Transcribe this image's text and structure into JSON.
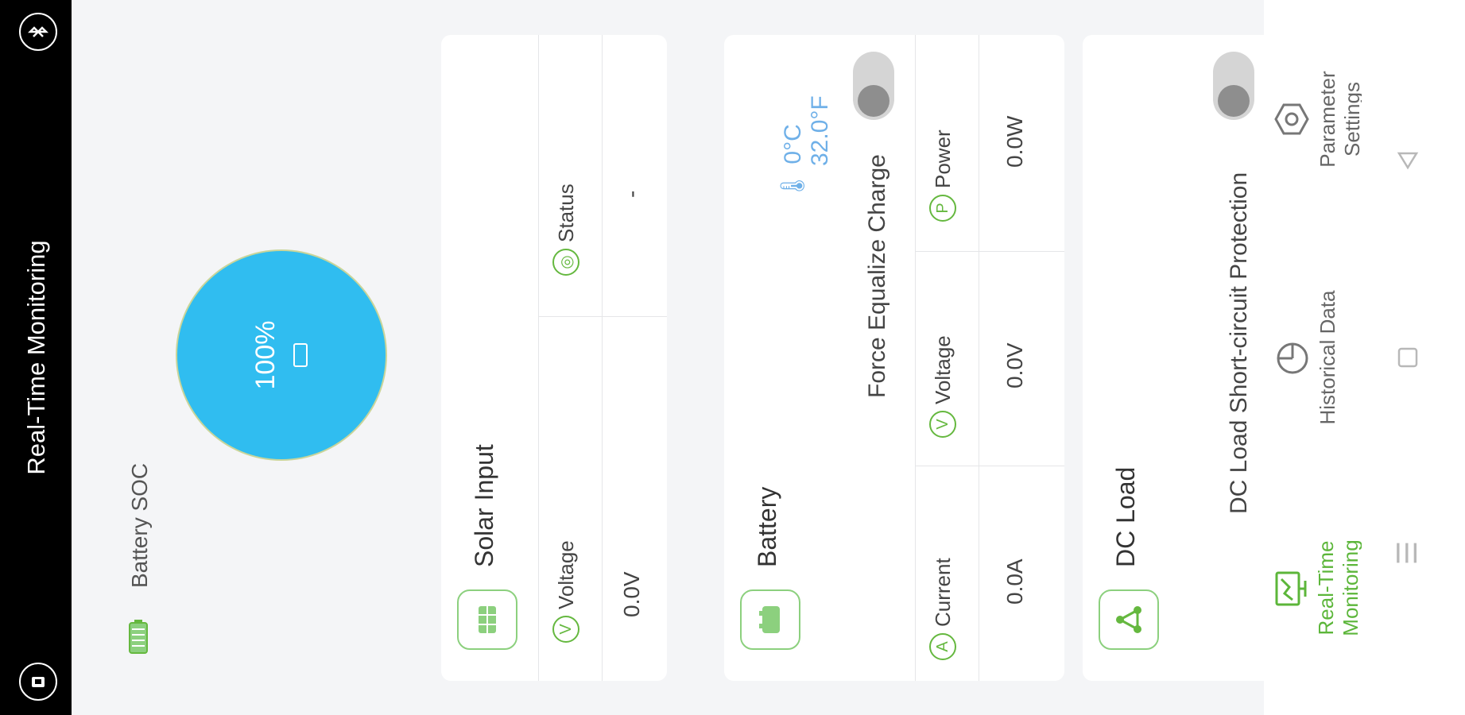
{
  "header": {
    "title": "Real-Time Monitoring",
    "bluetooth_icon": "bluetooth-icon",
    "exit_icon": "exit-icon"
  },
  "soc": {
    "label": "Battery SOC",
    "percent": "100%",
    "level": 1.0
  },
  "solar": {
    "title": "Solar Input",
    "voltage_label": "Voltage",
    "voltage_value": "0.0V",
    "status_label": "Status",
    "status_value": "-"
  },
  "battery": {
    "title": "Battery",
    "temp_c": "0°C",
    "temp_f": "32.0°F",
    "equalize_label": "Force Equalize Charge",
    "equalize_on": false,
    "current_label": "Current",
    "current_value": "0.0A",
    "voltage_label": "Voltage",
    "voltage_value": "0.0V",
    "power_label": "Power",
    "power_value": "0.0W"
  },
  "dc_load": {
    "title": "DC Load",
    "protection_label": "DC Load Short-circuit Protection",
    "protection_on": false
  },
  "bottom_nav": {
    "items": [
      {
        "label": "Real-Time Monitoring",
        "active": true
      },
      {
        "label": "Historical Data",
        "active": false
      },
      {
        "label": "Parameter Settings",
        "active": false
      }
    ]
  },
  "colors": {
    "accent": "#5cb63a",
    "soc_fill": "#30bdf0",
    "temp": "#6fb0e8"
  }
}
